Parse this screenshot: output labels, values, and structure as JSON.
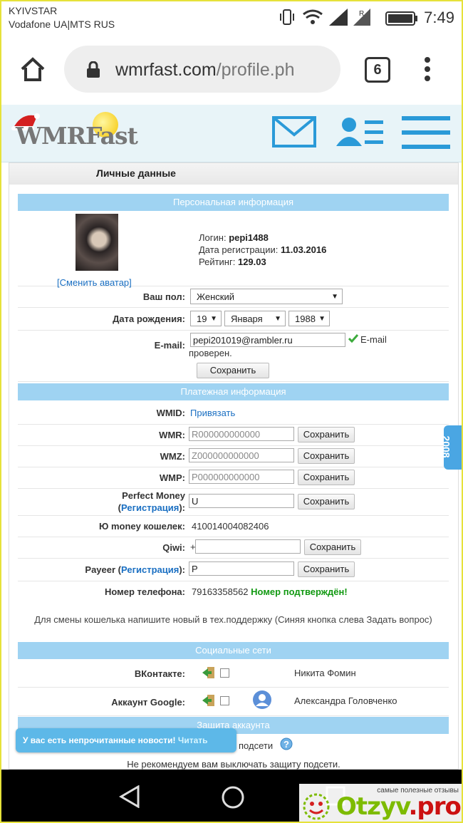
{
  "status_bar": {
    "carrier1": "KYIVSTAR",
    "carrier2": "Vodafone UA|MTS RUS",
    "time": "7:49"
  },
  "browser": {
    "url_main": "wmrfast.com",
    "url_path": "/profile.ph",
    "tab_count": "6"
  },
  "site": {
    "logo": "WMRFast"
  },
  "page": {
    "title": "Личные данные"
  },
  "personal": {
    "header": "Персональная информация",
    "change_avatar": "[Сменить аватар]",
    "login_label": "Логин:",
    "login_value": "pepi1488",
    "reg_label": "Дата регистрации:",
    "reg_value": "11.03.2016",
    "rating_label": "Рейтинг:",
    "rating_value": "129.03",
    "gender_label": "Ваш пол:",
    "gender_value": "Женский",
    "birth_label": "Дата рождения:",
    "birth_day": "19",
    "birth_month": "Января",
    "birth_year": "1988",
    "email_label": "E-mail:",
    "email_value": "pepi201019@rambler.ru",
    "email_status_1": "E-mail",
    "email_status_2": "проверен.",
    "save": "Сохранить"
  },
  "payment": {
    "header": "Платежная информация",
    "wmid_label": "WMID:",
    "wmid_link": "Привязать",
    "wmr_label": "WMR:",
    "wmr_placeholder": "R000000000000",
    "wmz_label": "WMZ:",
    "wmz_placeholder": "Z000000000000",
    "wmp_label": "WMP:",
    "wmp_placeholder": "P000000000000",
    "pm_label_1": "Perfect Money",
    "pm_label_2a": "(",
    "pm_label_link": "Регистрация",
    "pm_label_2b": "):",
    "pm_value": "U",
    "yoomoney_label": "Ю money кошелек:",
    "yoomoney_value": "410014004082406",
    "qiwi_label": "Qiwi:",
    "qiwi_value": "+",
    "payeer_label_a": "Payeer (",
    "payeer_link": "Регистрация",
    "payeer_label_b": "):",
    "payeer_value": "P",
    "phone_label": "Номер телефона:",
    "phone_value": "79163358562",
    "phone_status": "Номер подтверждён!",
    "save": "Сохранить",
    "note": "Для смены кошелька напишите новый в тех.поддержку (Синяя кнопка слева Задать вопрос)"
  },
  "social": {
    "header": "Социальные сети",
    "vk_label": "ВКонтакте:",
    "vk_name": "Никита Фомин",
    "google_label": "Аккаунт Google:",
    "google_name": "Александра Головченко"
  },
  "security": {
    "header": "Защита аккаунта",
    "line1": "подсети",
    "line2": "Не рекомендуем вам выключать защиту подсети."
  },
  "toast": {
    "text": "У вас есть непрочитанные новости!",
    "link": "Читать"
  },
  "side_tab": "2008",
  "watermark": {
    "tagline": "самые полезные отзывы",
    "logo_main": "Otzyv",
    "logo_dot": ".pro"
  },
  "colors": {
    "section_bar": "#9fd3f2",
    "link": "#1a6fc2",
    "accent_blue": "#4aa6e3",
    "confirm_green": "#119911"
  }
}
